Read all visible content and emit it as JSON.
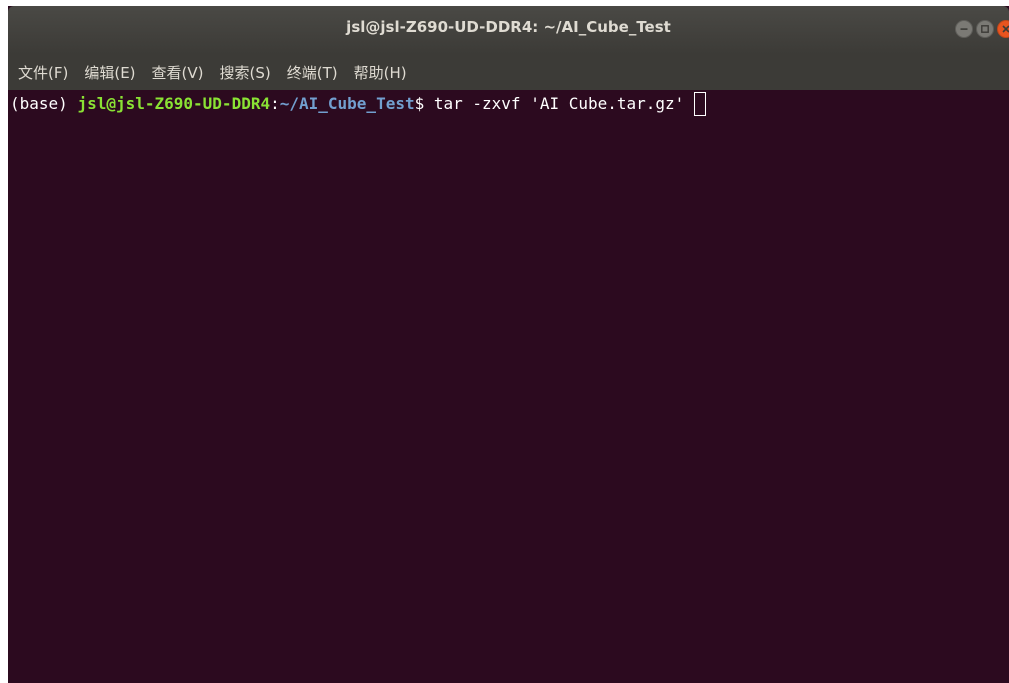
{
  "window": {
    "title": "jsl@jsl-Z690-UD-DDR4: ~/AI_Cube_Test"
  },
  "menu": {
    "items": [
      {
        "label": "文件(F)"
      },
      {
        "label": "编辑(E)"
      },
      {
        "label": "查看(V)"
      },
      {
        "label": "搜索(S)"
      },
      {
        "label": "终端(T)"
      },
      {
        "label": "帮助(H)"
      }
    ]
  },
  "terminal": {
    "env": "(base) ",
    "user_host": "jsl@jsl-Z690-UD-DDR4",
    "colon": ":",
    "path": "~/AI_Cube_Test",
    "dollar": "$ ",
    "command": "tar -zxvf 'AI Cube.tar.gz' "
  },
  "colors": {
    "terminal_bg": "#2c0a1f",
    "prompt_user": "#8ae234",
    "prompt_path": "#729fcf",
    "close_button": "#e9541f"
  },
  "icons": {
    "minimize": "minimize-icon",
    "maximize": "maximize-icon",
    "close": "close-icon"
  }
}
